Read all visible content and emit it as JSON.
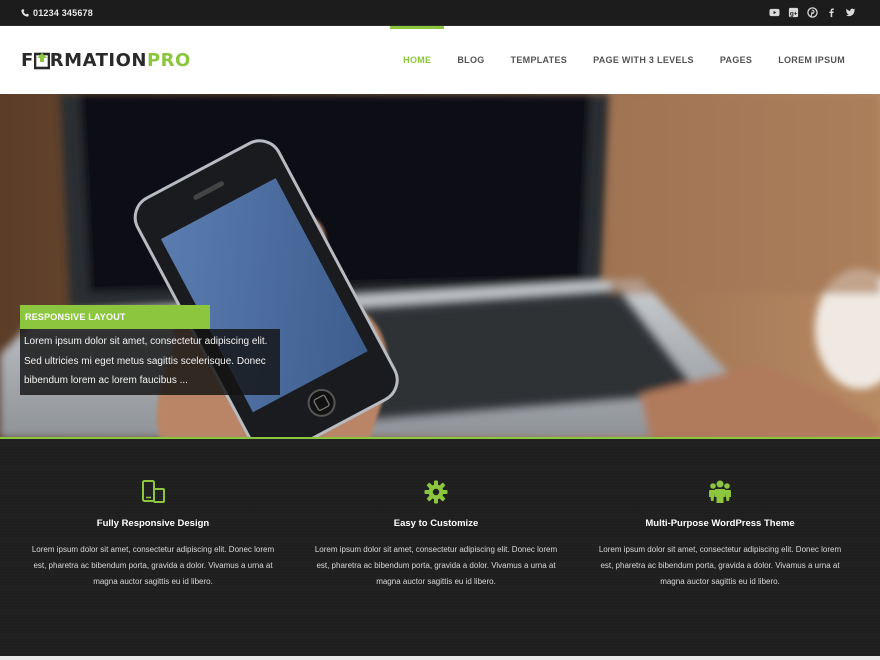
{
  "topbar": {
    "phone": "01234 345678",
    "phone_icon": "phone-icon",
    "socials": [
      "youtube-icon",
      "google-plus-icon",
      "pinterest-icon",
      "facebook-icon",
      "twitter-icon"
    ]
  },
  "header": {
    "logo": {
      "part1": "F",
      "part2": "RMATION",
      "part3": "PRO"
    },
    "nav": [
      "HOME",
      "BLOG",
      "TEMPLATES",
      "PAGE WITH 3 LEVELS",
      "PAGES",
      "LOREM IPSUM"
    ],
    "active_nav": "HOME"
  },
  "hero": {
    "caption_title": "RESPONSIVE LAYOUT",
    "caption_text": "Lorem ipsum dolor sit amet, consectetur adipiscing elit. Sed ultricies mi eget metus sagittis scelerisque. Donec bibendum lorem ac lorem faucibus ..."
  },
  "features": [
    {
      "icon": "mobile-tablet-icon",
      "title": "Fully Responsive Design",
      "text": "Lorem ipsum dolor sit amet, consectetur adipiscing elit. Donec lorem est, pharetra ac bibendum porta, gravida a dolor. Vivamus a urna at magna auctor sagittis eu id libero."
    },
    {
      "icon": "gear-icon",
      "title": "Easy to Customize",
      "text": "Lorem ipsum dolor sit amet, consectetur adipiscing elit. Donec lorem est, pharetra ac bibendum porta, gravida a dolor. Vivamus a urna at magna auctor sagittis eu id libero."
    },
    {
      "icon": "users-icon",
      "title": "Multi-Purpose WordPress Theme",
      "text": "Lorem ipsum dolor sit amet, consectetur adipiscing elit. Donec lorem est, pharetra ac bibendum porta, gravida a dolor. Vivamus a urna at magna auctor sagittis eu id libero."
    }
  ],
  "colors": {
    "accent": "#8cc63f",
    "dark": "#1f1f1f",
    "nav_text": "#555555"
  }
}
